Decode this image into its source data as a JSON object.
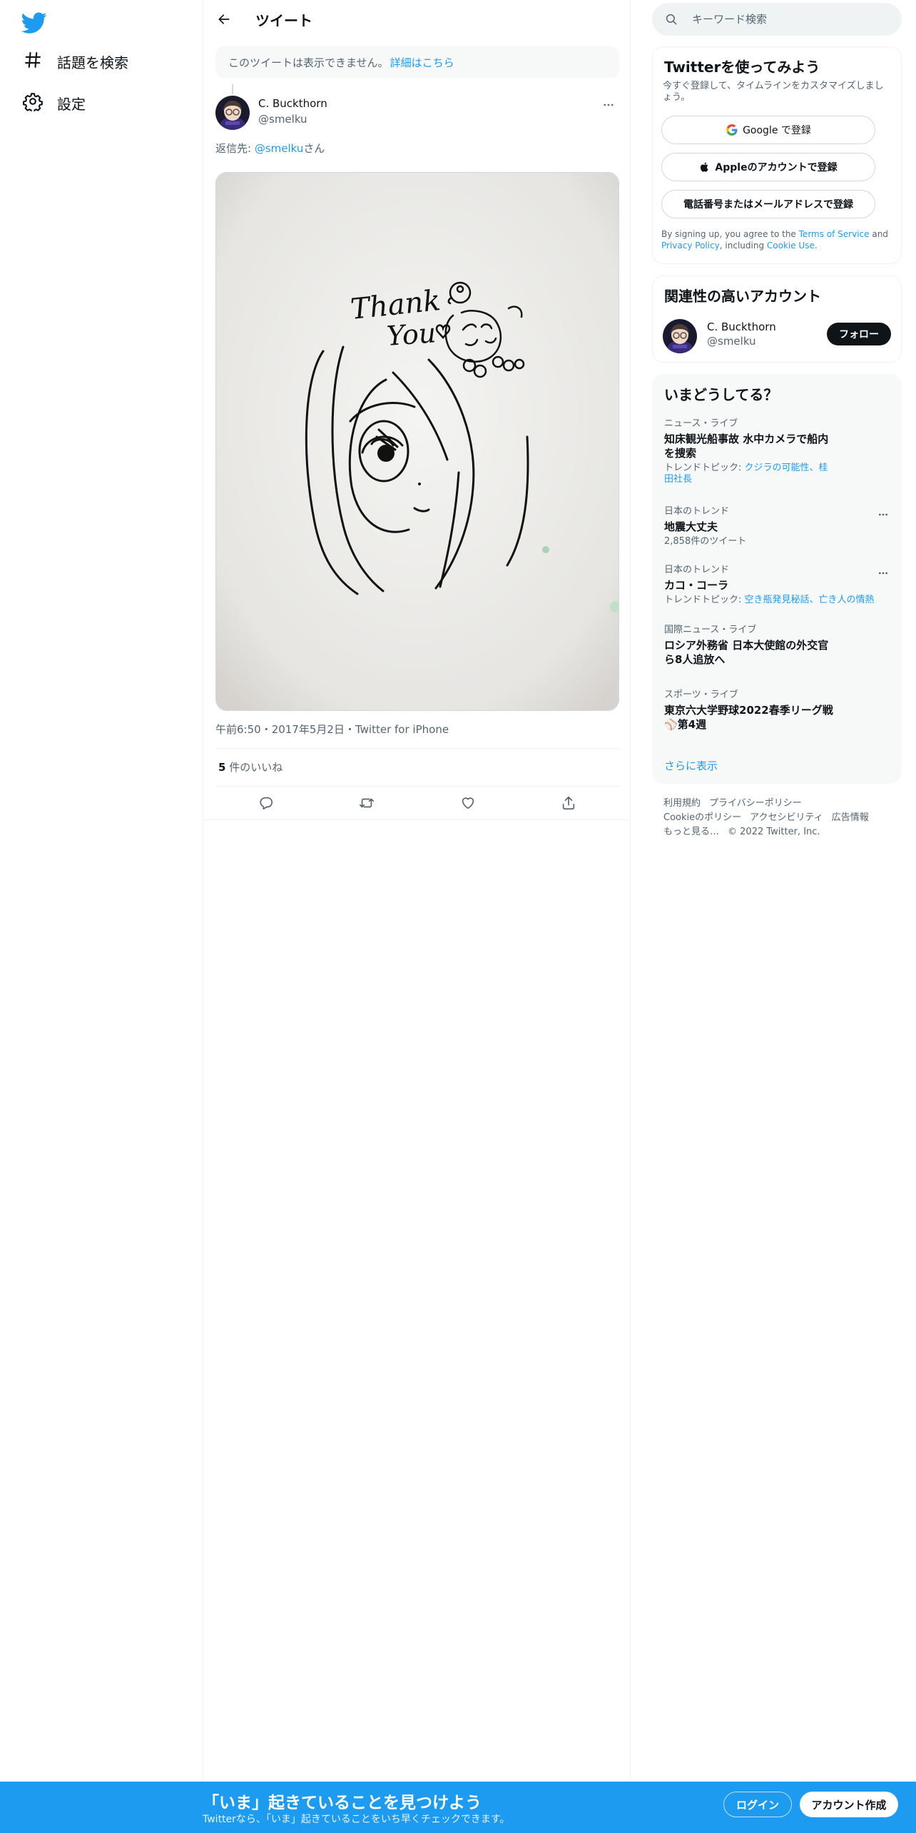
{
  "nav": {
    "items": [
      {
        "label": "話題を検索",
        "icon": "hashtag-icon"
      },
      {
        "label": "設定",
        "icon": "gear-icon"
      }
    ]
  },
  "header": {
    "title": "ツイート"
  },
  "notice": {
    "text": "このツイートは表示できません。",
    "link": "詳細はこちら"
  },
  "tweet": {
    "author_name": "C. Buckthorn",
    "author_handle": "@smelku",
    "reply_prefix": "返信先: ",
    "reply_mention": "@smelku",
    "reply_suffix": "さん",
    "image_text": [
      "Thank",
      "You"
    ],
    "time": "午前6:50",
    "date": "2017年5月2日",
    "source": "Twitter for iPhone",
    "separator": "・",
    "likes_count": "5",
    "likes_label": " 件のいいね"
  },
  "search": {
    "placeholder": "キーワード検索"
  },
  "signup": {
    "title": "Twitterを使ってみよう",
    "subtitle": "今すぐ登録して、タイムラインをカスタマイズしましょう。",
    "google": "Google で登録",
    "apple": "Appleのアカウントで登録",
    "phone": "電話番号またはメールアドレスで登録",
    "legal_1": "By signing up, you agree to the ",
    "terms": "Terms of Service",
    "legal_2": " and ",
    "privacy": "Privacy Policy",
    "legal_3": ", including ",
    "cookie": "Cookie Use",
    "legal_4": "."
  },
  "related": {
    "title": "関連性の高いアカウント",
    "name": "C. Buckthorn",
    "handle": "@smelku",
    "follow": "フォロー"
  },
  "trends": {
    "title": "いまどうしてる？",
    "items": [
      {
        "context": "ニュース・ライブ",
        "title": "知床観光船事故 水中カメラで船内を捜索",
        "sub_prefix": "トレンドトピック: ",
        "sub_links": "クジラの可能性、桂田社長"
      },
      {
        "context": "日本のトレンド",
        "title": "地震大丈夫",
        "sub": "2,858件のツイート"
      },
      {
        "context": "日本のトレンド",
        "title": "カコ・コーラ",
        "sub_prefix": "トレンドトピック: ",
        "sub_links": "空き瓶発見秘話、亡き人の情熱"
      },
      {
        "context": "国際ニュース・ライブ",
        "title": "ロシア外務省 日本大使館の外交官ら8人追放へ"
      },
      {
        "context": "スポーツ・ライブ",
        "title": "東京六大学野球2022春季リーグ戦 ⚾第4週"
      }
    ],
    "show_more": "さらに表示"
  },
  "footer": {
    "links": [
      "利用規約",
      "プライバシーポリシー",
      "Cookieのポリシー",
      "アクセシビリティ",
      "広告情報",
      "もっと見る…"
    ],
    "copyright": "© 2022 Twitter, Inc."
  },
  "bottom_bar": {
    "title": "「いま」起きていることを見つけよう",
    "subtitle": "Twitterなら、「いま」起きていることをいち早くチェックできます。",
    "login": "ログイン",
    "signup": "アカウント作成"
  },
  "colors": {
    "accent": "#1d9bf0",
    "text_primary": "#0f1419",
    "text_secondary": "#536471",
    "border": "#eff3f4",
    "follow_button": "#0f1419"
  }
}
